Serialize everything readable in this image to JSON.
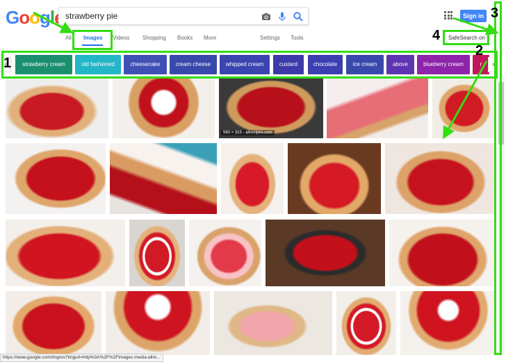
{
  "header": {
    "logo": "Google",
    "search_query": "strawberry pie",
    "signin_label": "Sign in"
  },
  "tabs": [
    {
      "label": "All"
    },
    {
      "label": "Images"
    },
    {
      "label": "Videos"
    },
    {
      "label": "Shopping"
    },
    {
      "label": "Books"
    },
    {
      "label": "More"
    },
    {
      "label": "Settings"
    },
    {
      "label": "Tools"
    }
  ],
  "safesearch_label": "SafeSearch on",
  "chips": [
    {
      "label": "strawberry cream",
      "color": "#1a8f6e"
    },
    {
      "label": "old fashioned",
      "color": "#23b6c7"
    },
    {
      "label": "cheesecake",
      "color": "#3f51b5"
    },
    {
      "label": "cream cheese",
      "color": "#3949ab"
    },
    {
      "label": "whipped cream",
      "color": "#3b45b0"
    },
    {
      "label": "custard",
      "color": "#3c3aa8"
    },
    {
      "label": "chocolate",
      "color": "#3b3fb0"
    },
    {
      "label": "ice cream",
      "color": "#3949ab"
    },
    {
      "label": "above",
      "color": "#5e35b1"
    },
    {
      "label": "blueberry cream",
      "color": "#8e24aa"
    },
    {
      "label": "r",
      "color": "#c2185b"
    }
  ],
  "image_caption": "560 × 315 - allrecipes.com",
  "status_url": "https://www.google.com/imgres?imgurl=http%3A%2F%2Fimages.media-allre...",
  "annotations": [
    "1",
    "2",
    "3",
    "4"
  ],
  "colors": {
    "accent": "#1a73e8",
    "annotation_green": "#33dd11",
    "signin_blue": "#4285f4"
  }
}
